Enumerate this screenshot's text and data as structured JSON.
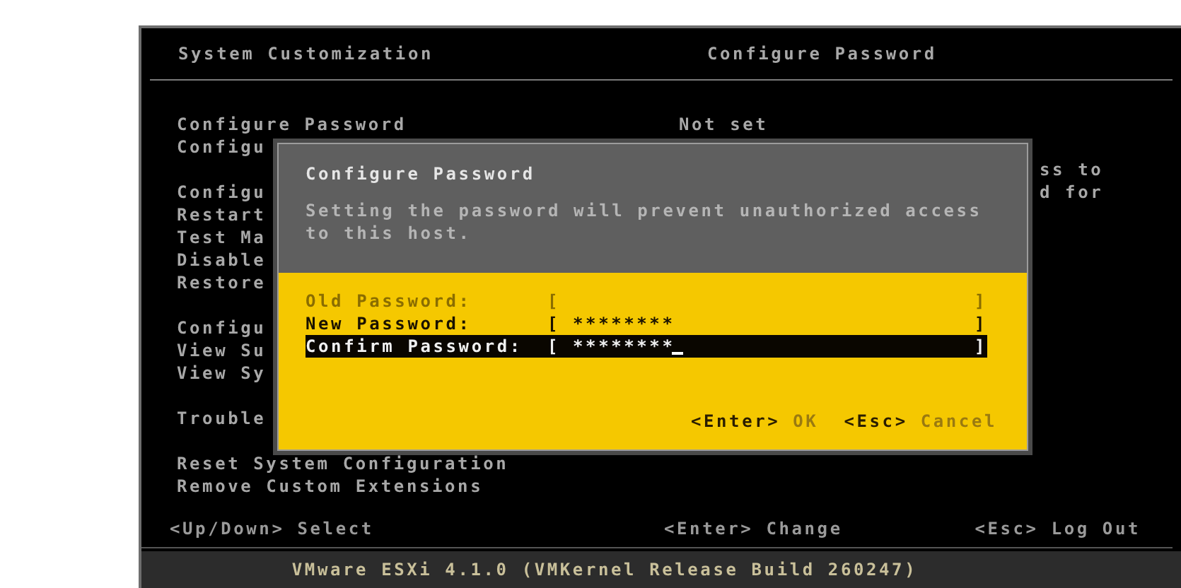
{
  "header": {
    "left_title": "System Customization",
    "right_title": "Configure Password"
  },
  "menu_groups": [
    [
      "Configure Password",
      "Configu"
    ],
    [
      "Configu",
      "Restart",
      "Test Ma",
      "Disable",
      "Restore"
    ],
    [
      "Configu",
      "View Su",
      "View Sy"
    ],
    [
      "Trouble"
    ],
    [
      "Reset System Configuration",
      "Remove Custom Extensions"
    ]
  ],
  "detail": {
    "value": "Not set",
    "text_fragments": [
      "ss to",
      "d for"
    ]
  },
  "footer_hints": [
    {
      "key": "<Up/Down>",
      "label": "Select"
    },
    {
      "key": "<Enter>",
      "label": "Change"
    },
    {
      "key": "<Esc>",
      "label": "Log Out"
    }
  ],
  "status_bar": "VMware ESXi 4.1.0 (VMKernel Release Build 260247)",
  "dialog": {
    "title": "Configure Password",
    "description": "Setting the password will prevent unauthorized access to this host.",
    "fields": [
      {
        "label": "Old Password:",
        "open": "[",
        "close": "]",
        "disabled": true,
        "selected": false
      },
      {
        "label": "New Password:",
        "open": "[",
        "value": "********",
        "close": "]",
        "disabled": false,
        "selected": false
      },
      {
        "label": "Confirm Password:",
        "open": "[",
        "value": "********",
        "close": "]",
        "disabled": false,
        "selected": true
      }
    ],
    "buttons": [
      {
        "key": "<Enter>",
        "label": "OK"
      },
      {
        "key": "<Esc>",
        "label": "Cancel"
      }
    ]
  }
}
